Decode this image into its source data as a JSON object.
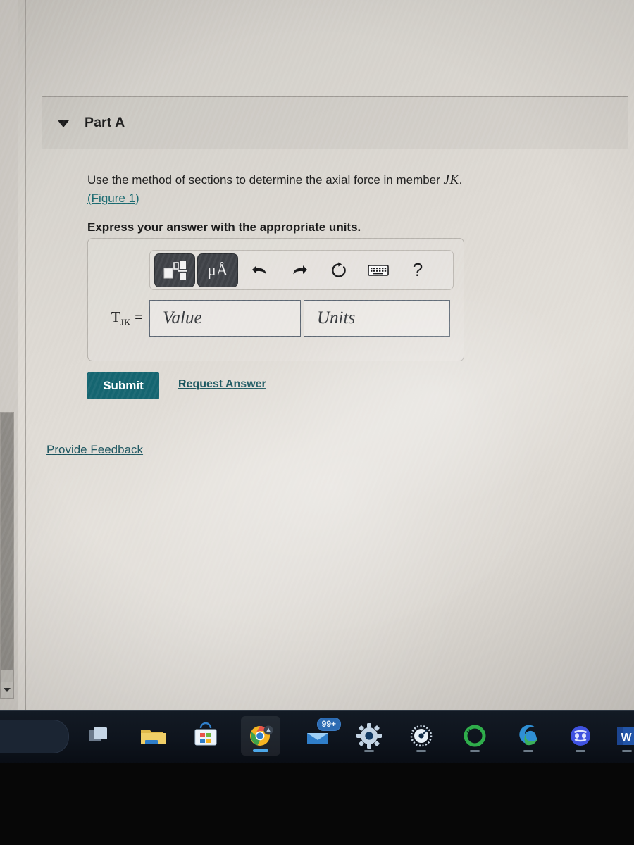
{
  "part": {
    "caret_icon": "caret-down-icon",
    "title": "Part A"
  },
  "prompt": {
    "line1_before": "Use the method of sections to determine the axial force in member ",
    "line1_variable": "JK",
    "line1_after": ".",
    "figure_link": "(Figure 1)",
    "instruction": "Express your answer with the appropriate units."
  },
  "toolbar": {
    "template_icon": "math-template-icon",
    "units_label": "μÅ",
    "undo_icon": "undo-arrow-icon",
    "redo_icon": "redo-arrow-icon",
    "reset_icon": "reset-circular-arrow-icon",
    "keyboard_icon": "keyboard-icon",
    "help_label": "?"
  },
  "answer": {
    "label_symbol": "T",
    "label_subscript": "JK",
    "label_equals": " =",
    "value_placeholder": "Value",
    "units_placeholder": "Units",
    "value": "",
    "units": ""
  },
  "actions": {
    "submit_label": "Submit",
    "request_answer_label": "Request Answer",
    "provide_feedback_label": "Provide Feedback"
  },
  "colors": {
    "submit_bg": "#156570",
    "link": "#17686e",
    "page_bg": "#d9d5cf",
    "taskbar_bg": "#0e141d"
  },
  "taskbar": {
    "search_pill": "search-pill",
    "items": [
      {
        "name": "task-view",
        "label": "Task View"
      },
      {
        "name": "file-explorer",
        "label": "File Explorer"
      },
      {
        "name": "microsoft-store",
        "label": "Microsoft Store"
      },
      {
        "name": "google-chrome",
        "label": "Google Chrome"
      },
      {
        "name": "mail",
        "label": "Mail",
        "badge": "99+"
      },
      {
        "name": "settings",
        "label": "Settings"
      },
      {
        "name": "gauge-app",
        "label": "Gauge"
      },
      {
        "name": "spotify",
        "label": "Spotify"
      },
      {
        "name": "microsoft-edge",
        "label": "Microsoft Edge"
      },
      {
        "name": "discord",
        "label": "Discord"
      },
      {
        "name": "microsoft-word",
        "label": "Word",
        "letter": "W"
      }
    ]
  }
}
